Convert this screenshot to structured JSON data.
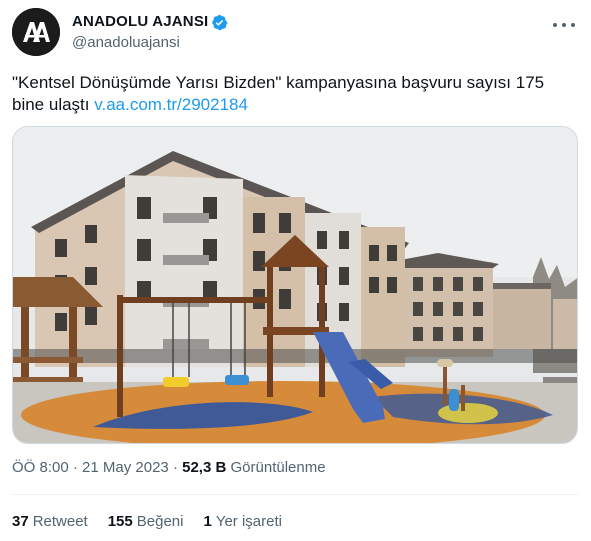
{
  "author": {
    "display_name": "ANADOLU AJANSI",
    "handle": "@anadoluajansi",
    "avatar_text": "AA",
    "verified": true
  },
  "tweet": {
    "text": "\"Kentsel Dönüşümde Yarısı Bizden\" kampanyasına başvuru sayısı 175 bine ulaştı",
    "link": "v.aa.com.tr/2902184"
  },
  "meta": {
    "time": "ÖÖ 8:00",
    "separator": "·",
    "date": "21 May 2023",
    "views_count": "52,3 B",
    "views_label": "Görüntülenme"
  },
  "stats": {
    "retweets_count": "37",
    "retweets_label": "Retweet",
    "likes_count": "155",
    "likes_label": "Beğeni",
    "bookmarks_count": "1",
    "bookmarks_label": "Yer işareti"
  },
  "colors": {
    "link": "#1d9bf0",
    "verified": "#1d9bf0",
    "secondary_text": "#536471"
  },
  "icons": [
    "verified-badge-icon",
    "more-options-icon"
  ]
}
